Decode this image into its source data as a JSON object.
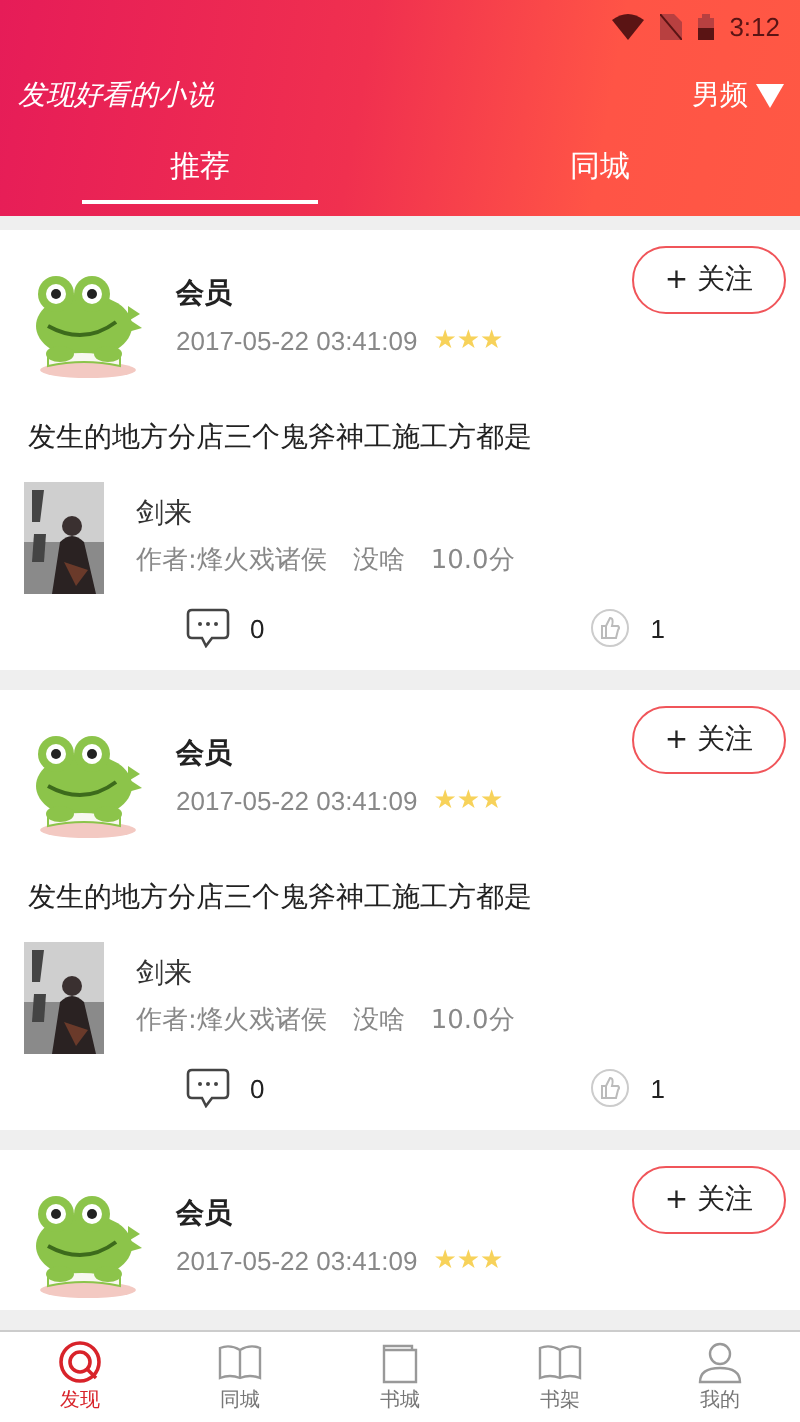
{
  "status_bar": {
    "time": "3:12"
  },
  "header": {
    "title": "发现好看的小说",
    "channel": "男频"
  },
  "tabs": [
    {
      "label": "推荐",
      "selected": true
    },
    {
      "label": "同城",
      "selected": false
    }
  ],
  "posts": [
    {
      "user": "会员",
      "time": "2017-05-22 03:41:09",
      "stars": 3,
      "follow": "+ 关注",
      "text": "发生的地方分店三个鬼斧神工施工方都是",
      "book": {
        "title": "剑来",
        "meta": "作者:烽火戏诸侯　没啥　10.0分"
      },
      "comments": "0",
      "likes": "1"
    },
    {
      "user": "会员",
      "time": "2017-05-22 03:41:09",
      "stars": 3,
      "follow": "+ 关注",
      "text": "发生的地方分店三个鬼斧神工施工方都是",
      "book": {
        "title": "剑来",
        "meta": "作者:烽火戏诸侯　没啥　10.0分"
      },
      "comments": "0",
      "likes": "1"
    },
    {
      "user": "会员",
      "time": "2017-05-22 03:41:09",
      "stars": 3,
      "follow": "+ 关注"
    }
  ],
  "nav": [
    {
      "label": "发现",
      "kind": "discover",
      "selected": true
    },
    {
      "label": "同城",
      "kind": "book",
      "selected": false
    },
    {
      "label": "书城",
      "kind": "store",
      "selected": false
    },
    {
      "label": "书架",
      "kind": "book",
      "selected": false
    },
    {
      "label": "我的",
      "kind": "user",
      "selected": false
    }
  ]
}
